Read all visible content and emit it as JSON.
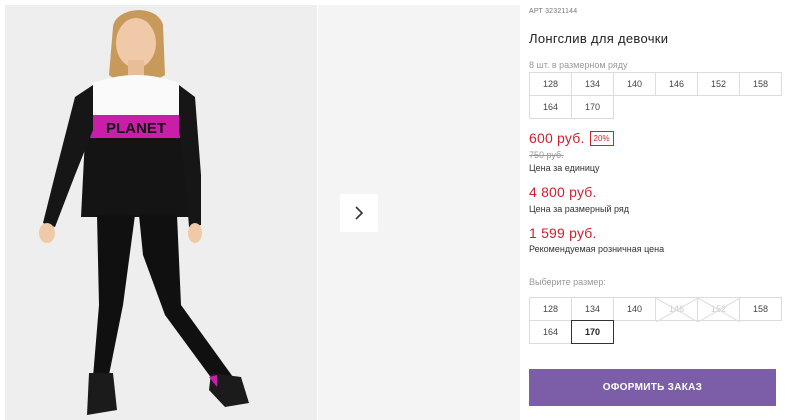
{
  "product": {
    "article_label": "АРТ",
    "article_number": "32321144",
    "title": "Лонгслив для девочки",
    "print_text": "PLANET"
  },
  "size_row": {
    "caption": "8 шт. в размерном ряду",
    "sizes": [
      "128",
      "134",
      "140",
      "146",
      "152",
      "158",
      "164",
      "170"
    ]
  },
  "pricing": {
    "price": "600 руб.",
    "discount": "20%",
    "old_price": "750 руб.",
    "unit_note": "Цена за единицу",
    "row_price": "4 800 руб.",
    "row_note": "Цена за размерный ряд",
    "retail_price": "1 599 руб.",
    "retail_note": "Рекомендуемая розничная цена"
  },
  "size_picker": {
    "caption": "Выберите размер:",
    "sizes": [
      {
        "label": "128",
        "state": "available"
      },
      {
        "label": "134",
        "state": "available"
      },
      {
        "label": "140",
        "state": "available"
      },
      {
        "label": "146",
        "state": "unavailable"
      },
      {
        "label": "152",
        "state": "unavailable"
      },
      {
        "label": "158",
        "state": "available"
      },
      {
        "label": "164",
        "state": "available"
      },
      {
        "label": "170",
        "state": "selected"
      }
    ]
  },
  "order_button": "ОФОРМИТЬ ЗАКАЗ",
  "gallery": {
    "next_icon": "chevron-right-icon"
  },
  "colors": {
    "price_red": "#d0202e",
    "order_button": "#7b5ea7",
    "print_magenta": "#c81ea8"
  }
}
